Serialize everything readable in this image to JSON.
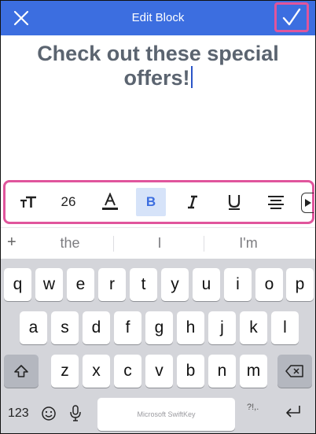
{
  "header": {
    "title": "Edit Block",
    "close_icon": "close-icon",
    "confirm_icon": "check-icon",
    "color": "#3c6ee0"
  },
  "editor": {
    "text": "Check out these special offers!"
  },
  "toolbar": {
    "font_size_value": "26",
    "bold_label": "B",
    "active_tool": "bold",
    "highlight_color": "#e0559c"
  },
  "suggestions": {
    "plus": "+",
    "items": [
      "the",
      "I",
      "I'm"
    ]
  },
  "keyboard": {
    "row1": [
      "q",
      "w",
      "e",
      "r",
      "t",
      "y",
      "u",
      "i",
      "o",
      "p"
    ],
    "row2": [
      "a",
      "s",
      "d",
      "f",
      "g",
      "h",
      "j",
      "k",
      "l"
    ],
    "row3": [
      "z",
      "x",
      "c",
      "v",
      "b",
      "n",
      "m"
    ],
    "numbers_label": "123",
    "space_label": "Microsoft SwiftKey",
    "punct_label": "?!,."
  }
}
